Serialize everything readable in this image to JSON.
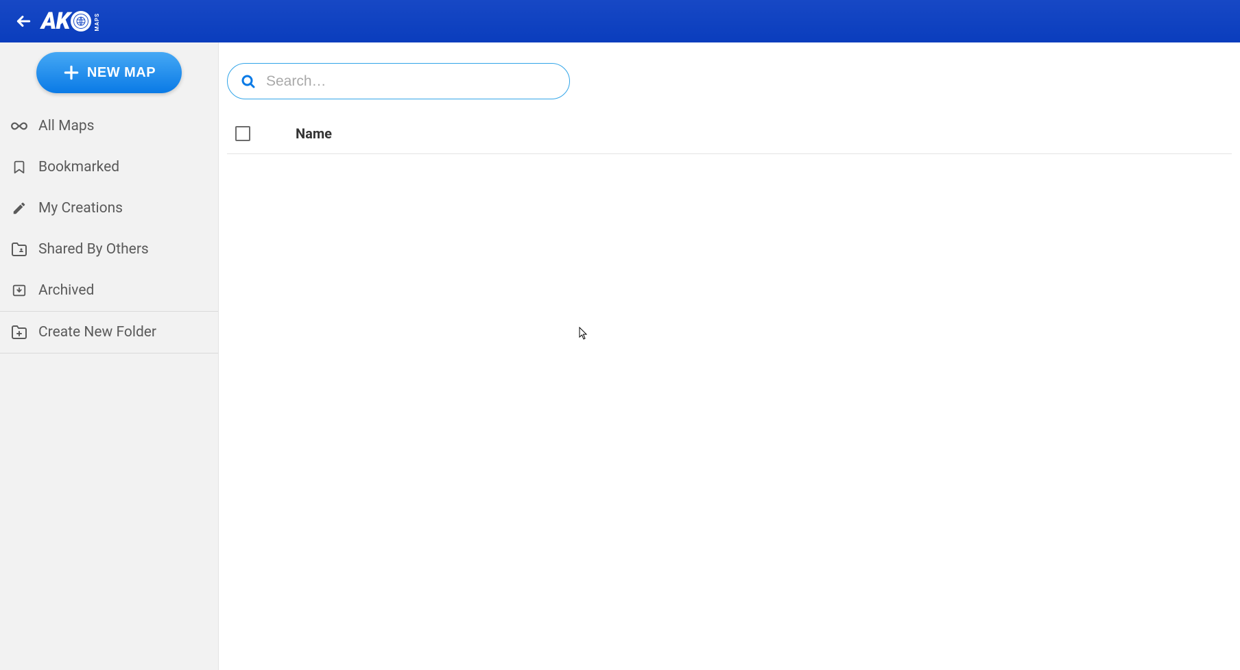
{
  "header": {
    "logo_main": "AK",
    "logo_sub": "MAPS"
  },
  "sidebar": {
    "new_map_label": "NEW MAP",
    "items": [
      {
        "label": "All Maps"
      },
      {
        "label": "Bookmarked"
      },
      {
        "label": "My Creations"
      },
      {
        "label": "Shared By Others"
      },
      {
        "label": "Archived"
      }
    ],
    "create_folder_label": "Create New Folder"
  },
  "main": {
    "search_placeholder": "Search…",
    "columns": {
      "name": "Name"
    }
  }
}
